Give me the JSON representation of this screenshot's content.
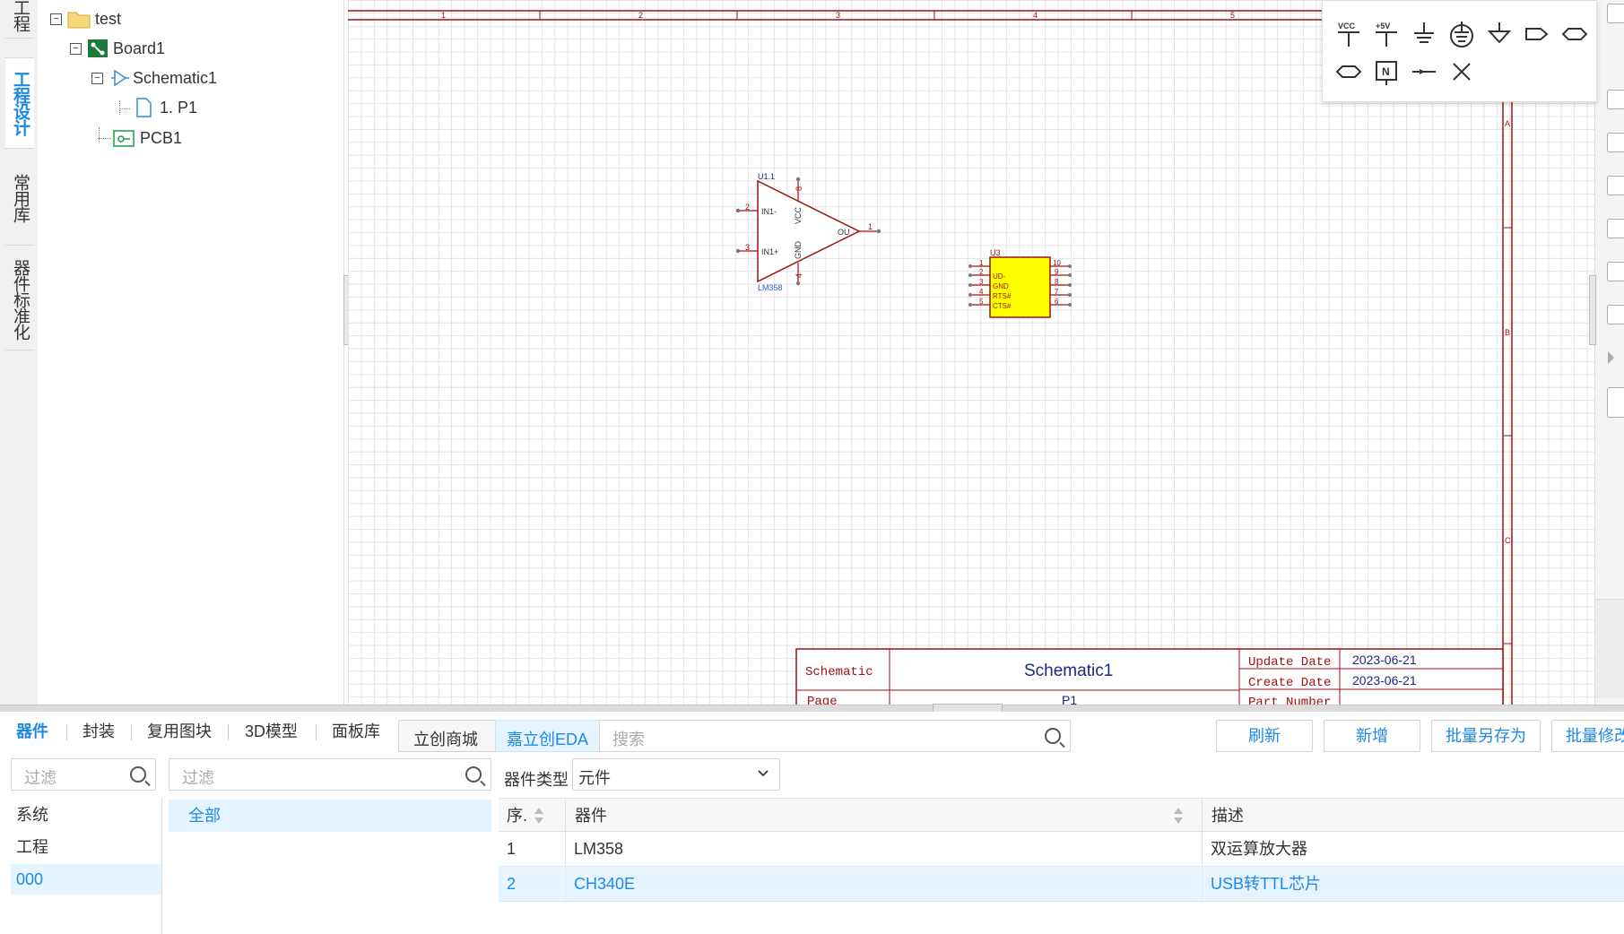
{
  "side_tabs": [
    {
      "label": "工程"
    },
    {
      "label": "工程设计",
      "active": true
    },
    {
      "label": "常用库"
    },
    {
      "label": "器件标准化"
    }
  ],
  "side_tab_partial": "常",
  "tree": {
    "project": "test",
    "board": "Board1",
    "schematic": "Schematic1",
    "page": "1. P1",
    "pcb": "PCB1"
  },
  "canvas": {
    "ruler_numbers": [
      "1",
      "2",
      "3",
      "4",
      "5"
    ],
    "ruler_letters": [
      "A",
      "B",
      "C"
    ],
    "opamp": {
      "designator": "U1.1",
      "part": "LM358",
      "pins": {
        "p2": "2",
        "p3": "3",
        "p8": "8",
        "p4": "4",
        "p1": "1"
      },
      "labels": {
        "in_minus": "IN1-",
        "in_plus": "IN1+",
        "vcc": "VCC",
        "gnd": "GND",
        "out": "OU"
      }
    },
    "chip": {
      "designator": "U3",
      "left_pins": [
        "1",
        "2",
        "3",
        "4",
        "5"
      ],
      "right_pins": [
        "10",
        "9",
        "8",
        "7",
        "6"
      ],
      "labels": [
        "UD-",
        "GND",
        "RTS#",
        "CTS#"
      ]
    },
    "title_block": {
      "schematic_label": "Schematic",
      "schematic_name": "Schematic1",
      "update_label": "Update Date",
      "update_value": "2023-06-21",
      "create_label": "Create Date",
      "create_value": "2023-06-21",
      "page_label": "Page",
      "page_value": "P1",
      "part_label": "Part Number"
    }
  },
  "symbols": {
    "vcc": "VCC",
    "p5v": "+5V",
    "netport": "N",
    "tools": [
      "vcc",
      "+5v",
      "ground",
      "earth",
      "gnd-arrow",
      "net-port-out",
      "net-port-bi",
      "net-port-in",
      "netport-n",
      "net-dot",
      "no-connect"
    ]
  },
  "library": {
    "tabs": [
      "器件",
      "封装",
      "复用图块",
      "3D模型",
      "面板库"
    ],
    "active_tab": "器件",
    "source_tabs": [
      "立创商城",
      "嘉立创EDA"
    ],
    "search_placeholder": "搜索",
    "buttons": [
      "刷新",
      "新增",
      "批量另存为",
      "批量修改"
    ],
    "filter1_placeholder": "过滤",
    "filter2_placeholder": "过滤",
    "categories": [
      "系统",
      "工程",
      "000"
    ],
    "selected_category": "000",
    "groups": [
      "全部"
    ],
    "type_label": "器件类型",
    "type_value": "元件",
    "table": {
      "headers": [
        "序.",
        "器件",
        "描述"
      ],
      "rows": [
        {
          "no": "1",
          "name": "LM358",
          "desc": "双运算放大器"
        },
        {
          "no": "2",
          "name": "CH340E",
          "desc": "USB转TTL芯片",
          "selected": true
        }
      ]
    }
  }
}
